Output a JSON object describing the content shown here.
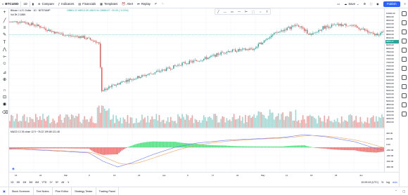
{
  "topbar": {
    "symbol": "BTCUSD",
    "interval": "1D",
    "compare": "Compare",
    "indicators": "Indicators",
    "financials": "Financials",
    "templates": "Templates",
    "alert": "Alert",
    "replay": "Replay",
    "save": "Save",
    "publish": "Publish"
  },
  "legend": {
    "title": "Bitcoin / U.S. Dollar · 1D · BITSTAMP",
    "ohlc": "O8861.22 H8913.28 L8823.94 C8865.47 −20.09 (−0.23%)",
    "vol": "Vol 3K 2.186K",
    "macd": "MACD 12 26 close 12 9  −78.22  199.68  121.46"
  },
  "price_axis": [
    "10000.00",
    "9800.00",
    "9600.00",
    "9400.00",
    "9200.00",
    "9000.00",
    "8800.00",
    "8600.00",
    "8400.00",
    "8200.00",
    "8000.00",
    "7800.00",
    "7600.00",
    "7400.00",
    "7200.00",
    "7000.00",
    "6800.00",
    "6600.00",
    "6400.00",
    "6200.00",
    "6000.00",
    "5800.00",
    "5600.00",
    "5400.00",
    "5200.00",
    "5000.00",
    "4800.00",
    "4600.00",
    "4400.00",
    "4200.00",
    "4000.00",
    "3800.00"
  ],
  "price_tag": "8865.47",
  "macd_axis": [
    "400.00",
    "200.00",
    "0.00",
    "-200.00",
    "-400.00",
    "-600.00",
    "-800.00"
  ],
  "time_axis": [
    "16",
    "24",
    "Mar",
    "9",
    "16",
    "23",
    "Apr",
    "9",
    "17",
    "24",
    "May",
    "11",
    "18",
    "25",
    "Jun"
  ],
  "time_readout": "10:09:43 (UTC)",
  "ranges": [
    "1D",
    "5D",
    "1M",
    "3M",
    "6M",
    "YTD",
    "1Y",
    "5Y",
    "All"
  ],
  "bottom_controls": [
    "%",
    "log",
    "auto"
  ],
  "bottom_tabs": [
    "Stock Screener",
    "Text Notes",
    "Pine Editor",
    "Strategy Tester",
    "Trading Panel"
  ],
  "colors": {
    "up": "#26a69a",
    "down": "#ef5350",
    "vol_up": "#9fd8d3",
    "vol_down": "#f5a3a2",
    "macd": "#6f7cf5",
    "signal": "#f4a35a",
    "hist_up": "#26d962",
    "hist_down": "#ef5350",
    "accent": "#2962ff"
  },
  "left_tools": [
    "crosshair-icon",
    "trend-line-icon",
    "fib-icon",
    "brush-icon",
    "text-icon",
    "pattern-icon",
    "forecast-icon",
    "emoji-icon",
    "ruler-icon",
    "zoom-icon",
    "magnet-icon",
    "lock-icon",
    "eye-icon",
    "trash-icon"
  ],
  "right_tools": [
    "watchlist-icon",
    "alerts-icon",
    "data-window-icon",
    "hotlist-icon",
    "calendar-icon",
    "ideas-icon",
    "chat-icon",
    "streams-icon",
    "notifications-icon",
    "order-panel-icon",
    "dom-icon",
    "help-icon"
  ]
}
